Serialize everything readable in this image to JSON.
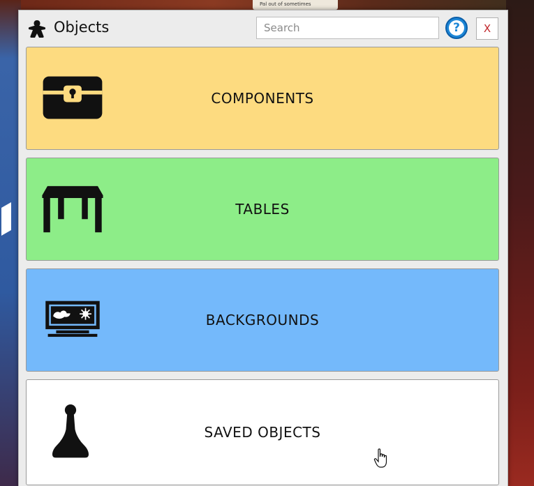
{
  "background": {
    "card_text": "Pal out of sometimes"
  },
  "panel": {
    "title": "Objects",
    "title_icon": "meeple-icon",
    "search": {
      "placeholder": "Search",
      "value": ""
    },
    "help_label": "?",
    "close_label": "X"
  },
  "tiles": [
    {
      "label": "COMPONENTS",
      "icon": "treasure-chest-icon",
      "color": "#fddb80"
    },
    {
      "label": "TABLES",
      "icon": "table-icon",
      "color": "#8ded88"
    },
    {
      "label": "BACKGROUNDS",
      "icon": "landscape-monitor-icon",
      "color": "#74b9fb"
    },
    {
      "label": "SAVED OBJECTS",
      "icon": "pawn-icon",
      "color": "#ffffff"
    }
  ],
  "colors": {
    "help_blue": "#1d86d6",
    "close_red": "#c0262b"
  }
}
